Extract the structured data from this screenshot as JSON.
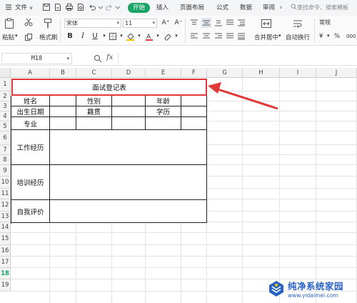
{
  "menubar": {
    "file_menu": "文件",
    "file_dropdown": "∨",
    "start_tab": "开始",
    "tabs": [
      "插入",
      "页面布局",
      "公式",
      "数据",
      "审阅"
    ],
    "more": "›",
    "search_placeholder": "查找命令、搜索模板"
  },
  "ribbon": {
    "paste_label": "粘贴",
    "format_painter_label": "格式刷",
    "font_name": "宋体",
    "font_size": "11",
    "grow_font": "A⁺",
    "shrink_font": "A⁻",
    "bold": "B",
    "italic": "I",
    "underline": "U",
    "merge_label": "合并居中",
    "wrap_label": "自动换行",
    "number_format": "常规",
    "currency": "¥",
    "percent": "%",
    "thousands": "000"
  },
  "formula_bar": {
    "name_box": "M18",
    "fx": "fx"
  },
  "grid": {
    "columns": [
      "A",
      "B",
      "C",
      "D",
      "E",
      "F",
      "G",
      "H",
      "I",
      "J"
    ],
    "rows": [
      "1",
      "2",
      "3",
      "4",
      "5",
      "6",
      "7",
      "8",
      "9",
      "10",
      "11",
      "12",
      "13",
      "14",
      "15",
      "16",
      "17",
      "18",
      "19"
    ],
    "selected_row": "18"
  },
  "table": {
    "title": "面试登记表",
    "name_label": "姓名",
    "gender_label": "性别",
    "age_label": "年龄",
    "birth_label": "出生日期",
    "origin_label": "籍贯",
    "education_label": "学历",
    "major_label": "专业",
    "work_label": "工作经历",
    "training_label": "培训经历",
    "self_eval_label": "自我评价"
  },
  "watermark": {
    "title": "纯净系统家园",
    "url": "www.yidaimei.com"
  },
  "colors": {
    "accent": "#1aa567",
    "highlight_red": "#e0393a",
    "watermark_blue": "#2a63c4"
  }
}
